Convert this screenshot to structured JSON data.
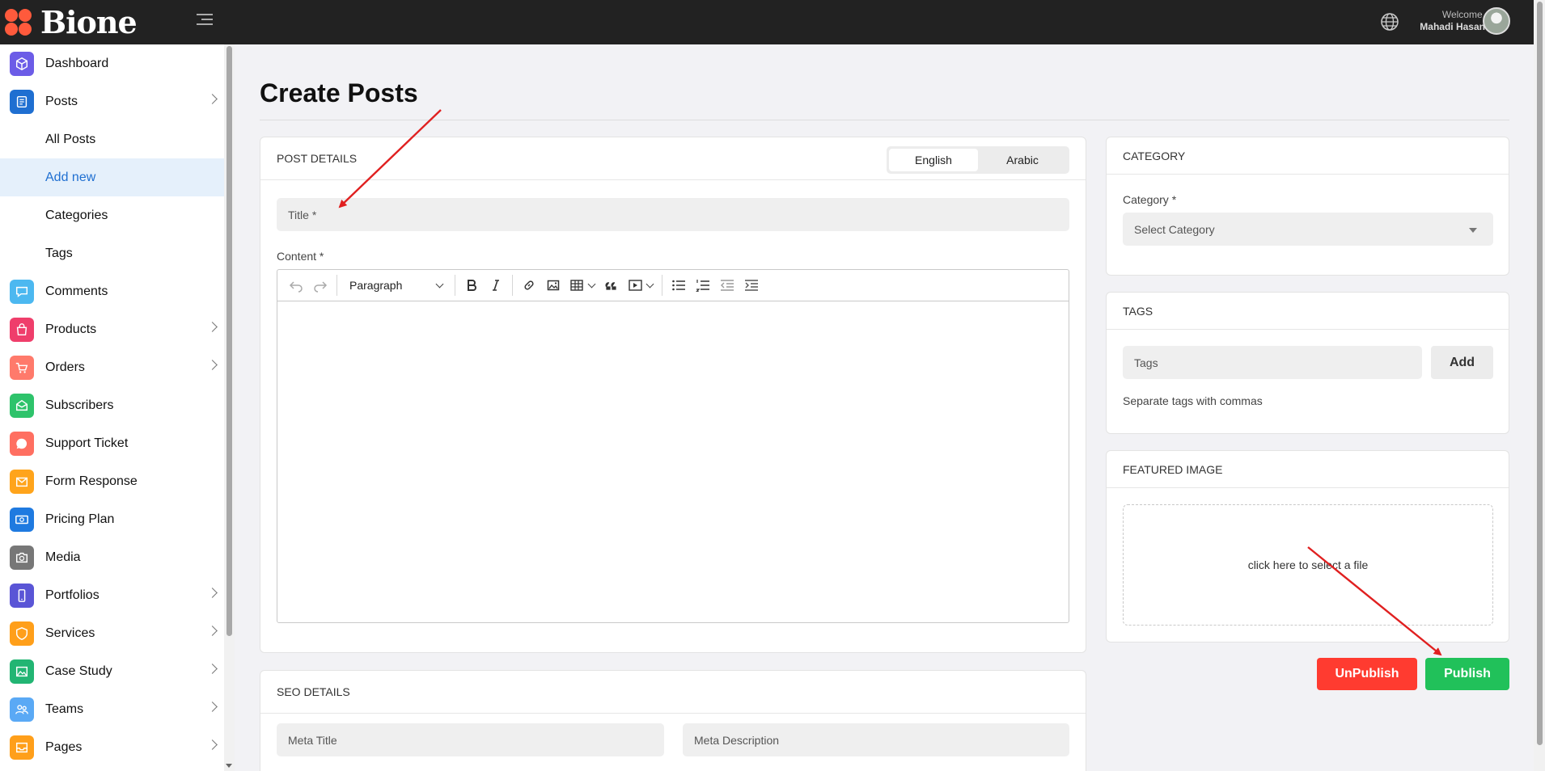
{
  "brand": {
    "name": "Bione",
    "color": "#ff5a3c"
  },
  "topbar": {
    "welcome": "Welcome,",
    "user_name": "Mahadi Hasan"
  },
  "sidebar": {
    "items": [
      {
        "label": "Dashboard",
        "icon": "cube-icon",
        "color": "#6c5ce7",
        "chevron": false
      },
      {
        "label": "Posts",
        "icon": "document-icon",
        "color": "#1f6fd1",
        "chevron": true
      },
      {
        "label": "Comments",
        "icon": "chat-icon",
        "color": "#4cb8f0",
        "chevron": false
      },
      {
        "label": "Products",
        "icon": "bag-icon",
        "color": "#ef3e6b",
        "chevron": true
      },
      {
        "label": "Orders",
        "icon": "cart-icon",
        "color": "#ff7a6b",
        "chevron": true
      },
      {
        "label": "Subscribers",
        "icon": "envelope-icon",
        "color": "#2ec36b",
        "chevron": false
      },
      {
        "label": "Support Ticket",
        "icon": "bubble-icon",
        "color": "#ff6f61",
        "chevron": false
      },
      {
        "label": "Form Response",
        "icon": "mail-icon",
        "color": "#ffa41b",
        "chevron": false
      },
      {
        "label": "Pricing Plan",
        "icon": "money-icon",
        "color": "#1f7ae0",
        "chevron": false
      },
      {
        "label": "Media",
        "icon": "camera-icon",
        "color": "#777777",
        "chevron": false
      },
      {
        "label": "Portfolios",
        "icon": "phone-icon",
        "color": "#5a55d6",
        "chevron": true
      },
      {
        "label": "Services",
        "icon": "shield-icon",
        "color": "#ff9f1a",
        "chevron": true
      },
      {
        "label": "Case Study",
        "icon": "image-icon",
        "color": "#22b573",
        "chevron": true
      },
      {
        "label": "Teams",
        "icon": "users-icon",
        "color": "#5aa9f5",
        "chevron": true
      },
      {
        "label": "Pages",
        "icon": "inbox-icon",
        "color": "#ff9f1a",
        "chevron": true
      }
    ],
    "posts_sub": [
      {
        "label": "All Posts"
      },
      {
        "label": "Add new"
      },
      {
        "label": "Categories"
      },
      {
        "label": "Tags"
      }
    ]
  },
  "main": {
    "page_title": "Create Posts",
    "post_details": {
      "header": "POST DETAILS",
      "lang_options": [
        "English",
        "Arabic"
      ],
      "title_placeholder": "Title *",
      "content_label": "Content *",
      "paragraph_label": "Paragraph"
    },
    "seo": {
      "header": "SEO DETAILS",
      "meta_title_placeholder": "Meta Title",
      "meta_description_placeholder": "Meta Description"
    },
    "category": {
      "header": "CATEGORY",
      "label": "Category *",
      "selected": "Select Category"
    },
    "tags": {
      "header": "TAGS",
      "placeholder": "Tags",
      "add_label": "Add",
      "hint": "Separate tags with commas"
    },
    "featured_image": {
      "header": "FEATURED IMAGE",
      "dropzone": "click here to select a file"
    },
    "actions": {
      "unpublish": "UnPublish",
      "publish": "Publish"
    }
  }
}
